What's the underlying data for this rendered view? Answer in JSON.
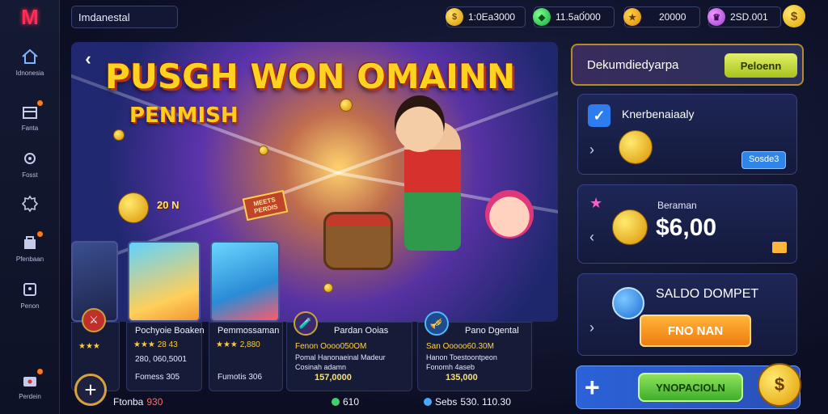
{
  "sidebar": {
    "logo": "M",
    "items": [
      {
        "label": "Idnonesia",
        "icon": "home-icon"
      },
      {
        "label": "Fanta",
        "icon": "gift-icon"
      },
      {
        "label": "Fosst",
        "icon": "gear-icon"
      },
      {
        "label": "",
        "icon": "settings-icon"
      },
      {
        "label": "Pfenbaan",
        "icon": "store-icon"
      },
      {
        "label": "Penon",
        "icon": "lock-icon"
      },
      {
        "label": "Perdein",
        "icon": "bag-icon"
      }
    ]
  },
  "topbar": {
    "search_value": "Imdanestal",
    "currencies": [
      {
        "value": "1:0Ea3000",
        "icon": "coin-icon"
      },
      {
        "value": "11.5a0́000",
        "icon": "gem-icon"
      },
      {
        "value": "20000",
        "icon": "trophy-icon"
      },
      {
        "value": "2SD.001",
        "icon": "crown-icon"
      }
    ]
  },
  "banner": {
    "headline": "PUSGH WON OMAINN",
    "subheadline": "PENMISH",
    "amount_tag": "20 N",
    "crate_text": "MEETS PERDIS"
  },
  "cards": [
    {
      "title": "Pochyoie Boaken",
      "rating_count": "28 43",
      "line1": "280, 060,5001",
      "value": "Fomess 305"
    },
    {
      "title": "Pemmossaman",
      "rating_count": "2,880",
      "line1": "",
      "value": "Fumotis 306"
    },
    {
      "title": "Pardan Ooias",
      "line1": "Fenon Oooo050OM",
      "line2": "Pomal Hanonaeinal Madeur",
      "line3": "Cosinah  adamn",
      "value": "157,0000"
    },
    {
      "title": "Pano Dgental",
      "line1": "San Ooooo60.30M",
      "line2": "Hanon Toestoontpeon",
      "line3": "Fonomh  4aseb",
      "value": "135,000"
    }
  ],
  "bottom_stats": [
    {
      "label": "Ftonba",
      "value": "930"
    },
    {
      "label": "",
      "value": "610"
    },
    {
      "label": "Sebs",
      "value": "530. 110.30"
    }
  ],
  "right_panel": {
    "header_text": "Dekumdiedyarpa",
    "header_button": "Peloenn",
    "daily": {
      "title": "Knerbenaiaaly",
      "button": "Sosde3"
    },
    "balance": {
      "label": "Beraman",
      "amount": "$6,00"
    },
    "wallet": {
      "title": "SALDO DOMPET",
      "button": "FNO NAN"
    },
    "promo_button": "YNOPACIOLN"
  },
  "colors": {
    "accent_gold": "#ffd21f",
    "accent_blue": "#2f86ea",
    "accent_orange": "#ef7c10",
    "accent_green": "#3fae2c",
    "logo_red": "#ff2d55"
  }
}
